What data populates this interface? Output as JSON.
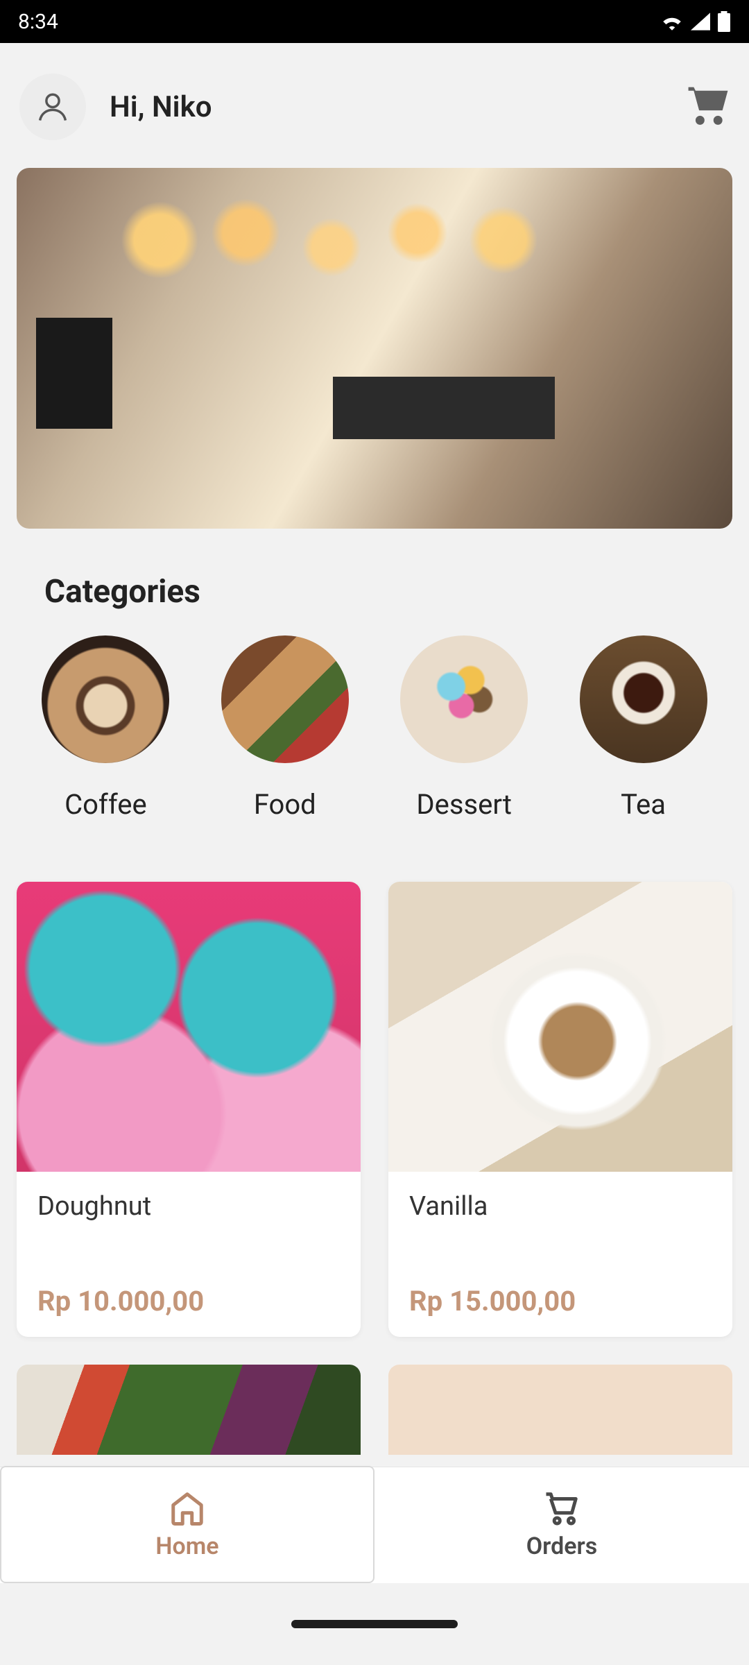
{
  "status": {
    "time": "8:34"
  },
  "header": {
    "greeting": "Hi, Niko"
  },
  "sections": {
    "categories_title": "Categories"
  },
  "categories": [
    {
      "label": "Coffee"
    },
    {
      "label": "Food"
    },
    {
      "label": "Dessert"
    },
    {
      "label": "Tea"
    }
  ],
  "products": [
    {
      "name": "Doughnut",
      "price": "Rp 10.000,00"
    },
    {
      "name": "Vanilla",
      "price": "Rp 15.000,00"
    }
  ],
  "nav": {
    "home": "Home",
    "orders": "Orders"
  },
  "accent": "#c49679"
}
